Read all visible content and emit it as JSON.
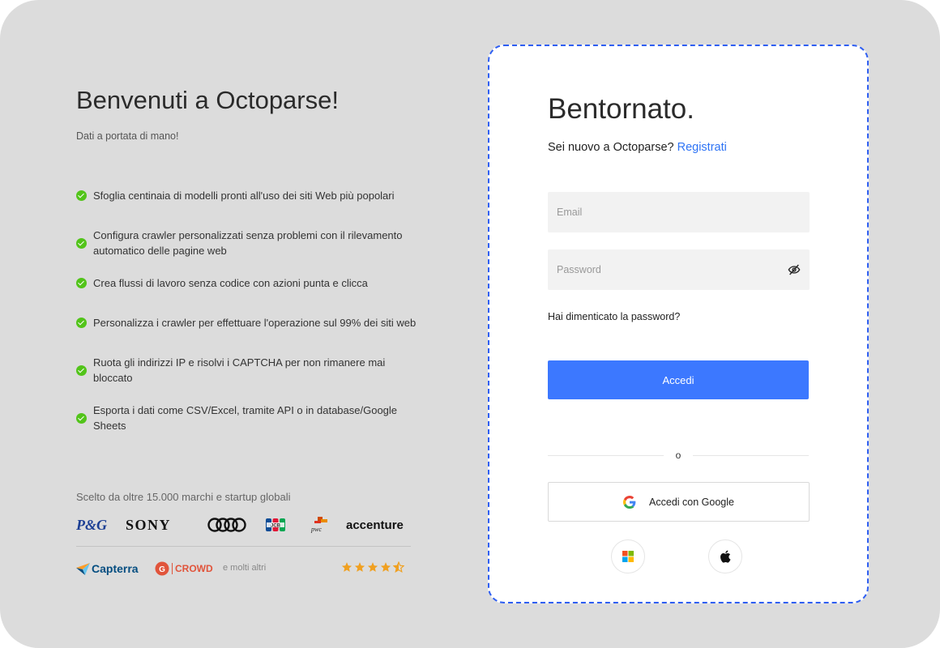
{
  "left": {
    "title": "Benvenuti a Octoparse!",
    "subtitle": "Dati a portata di mano!",
    "features": [
      "Sfoglia centinaia di modelli pronti all'uso dei siti Web più popolari",
      "Configura crawler personalizzati senza problemi con il rilevamento automatico delle pagine web",
      "Crea flussi di lavoro senza codice con azioni punta e clicca",
      "Personalizza i crawler per effettuare l'operazione sul 99% dei siti web",
      "Ruota gli indirizzi IP e risolvi i CAPTCHA per non rimanere mai bloccato",
      "Esporta i dati come CSV/Excel, tramite API o in database/Google Sheets"
    ],
    "brands_caption": "Scelto da oltre 15.000 marchi e startup globali",
    "brand_logos": {
      "pg": "P&G",
      "sony": "SONY",
      "audi": "audi-logo",
      "jcb": "jcb-logo",
      "pwc": "pwc",
      "accenture": "accenture"
    },
    "reviews": {
      "capterra": "Capterra",
      "g2": "CROWD",
      "more": "e molti altri",
      "rating": 4.5
    }
  },
  "card": {
    "title": "Bentornato.",
    "new_user_text": "Sei nuovo a Octoparse?",
    "register_link": "Registrati",
    "email_placeholder": "Email",
    "password_placeholder": "Password",
    "forgot_password": "Hai dimenticato la password?",
    "login_button": "Accedi",
    "or_text": "o",
    "google_button": "Accedi con Google",
    "social_buttons": [
      "microsoft-icon",
      "apple-icon"
    ]
  },
  "colors": {
    "background": "#dcdcdc",
    "primary": "#3c78ff",
    "link": "#2f74f5",
    "check": "#52c41a",
    "star": "#f0a020",
    "card_border": "#2f5ff2"
  }
}
